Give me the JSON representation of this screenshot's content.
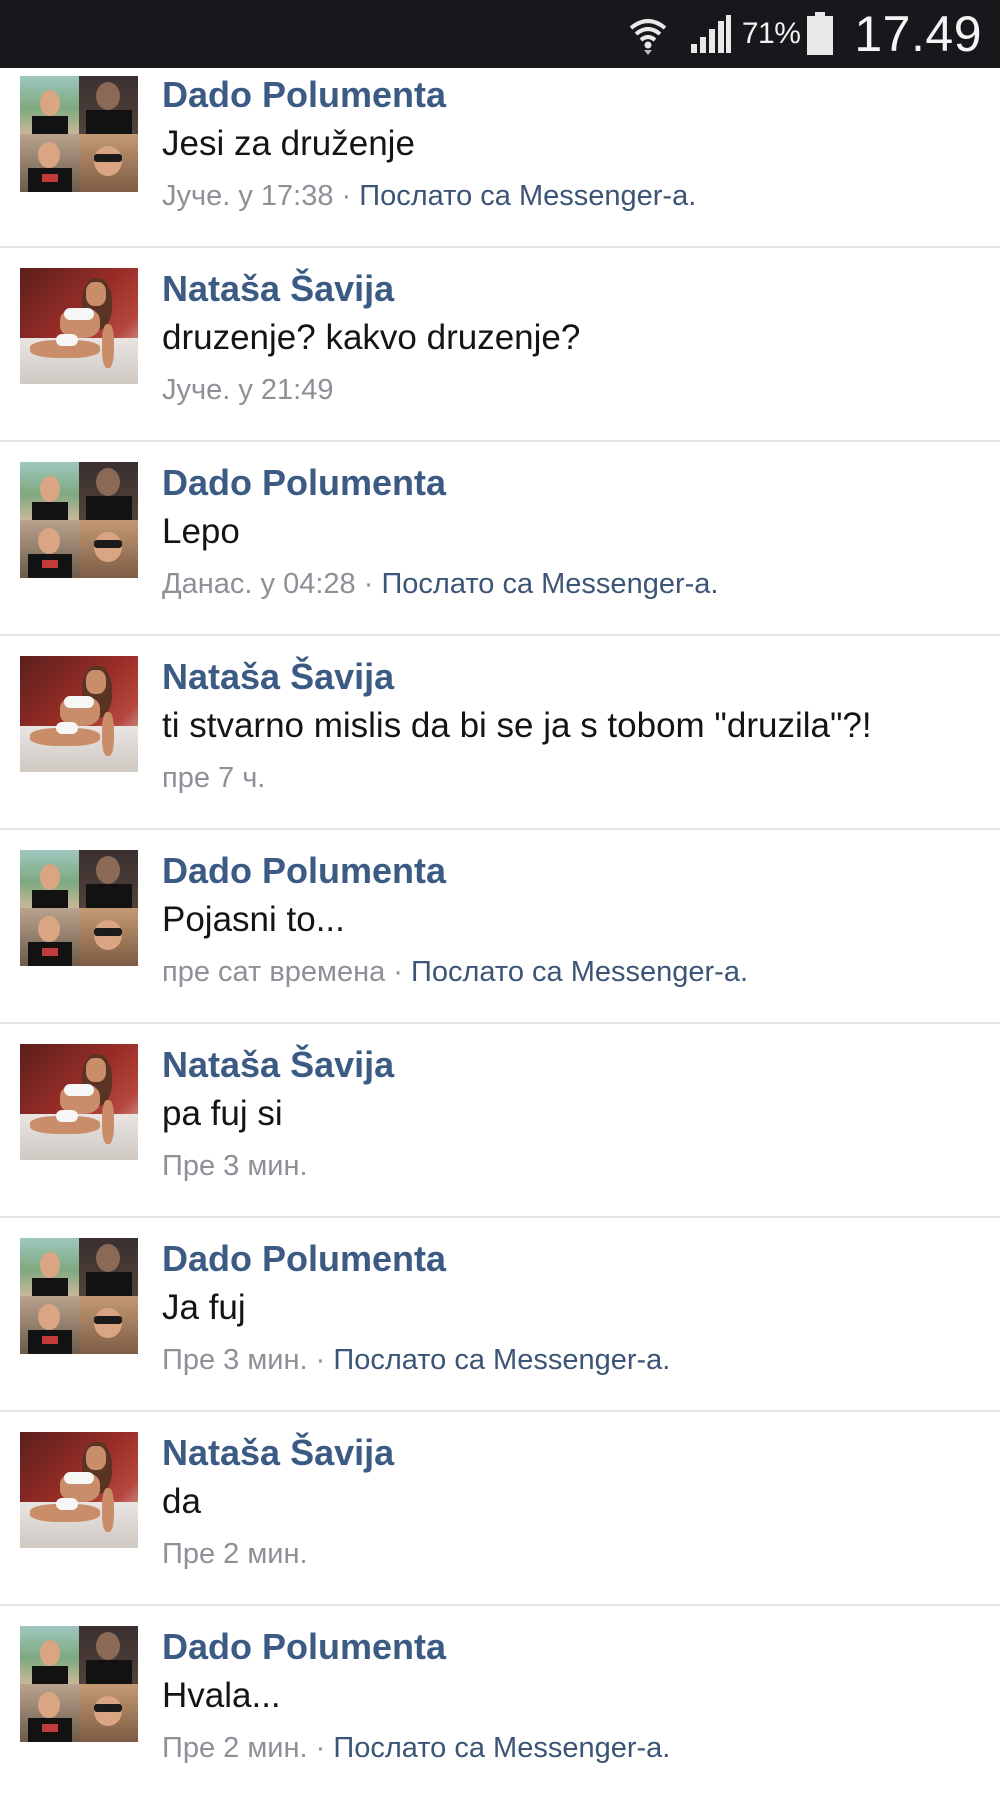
{
  "status_bar": {
    "battery_percent": "71%",
    "clock": "17.49",
    "icons": [
      "wifi-icon",
      "signal-icon",
      "battery-icon"
    ]
  },
  "messages": [
    {
      "sender": "Dado Polumenta",
      "avatar": "dado-avatar",
      "text": "Jesi za druženje",
      "time": "Јуче. у 17:38",
      "separator": " · ",
      "source": "Послато са Messenger-а."
    },
    {
      "sender": "Nataša Šavija",
      "avatar": "natasa-avatar",
      "text": "druzenje? kakvo druzenje?",
      "time": "Јуче. у 21:49"
    },
    {
      "sender": "Dado Polumenta",
      "avatar": "dado-avatar",
      "text": "Lepo",
      "time": "Данас. у 04:28",
      "separator": " · ",
      "source": "Послато са Messenger-а."
    },
    {
      "sender": "Nataša Šavija",
      "avatar": "natasa-avatar",
      "text": "ti stvarno mislis da bi se ja s tobom \"druzila\"?!",
      "time": "пре 7 ч."
    },
    {
      "sender": "Dado Polumenta",
      "avatar": "dado-avatar",
      "text": "Pojasni to...",
      "time": "пре сат времена",
      "separator": " · ",
      "source": "Послато са Messenger-а."
    },
    {
      "sender": "Nataša Šavija",
      "avatar": "natasa-avatar",
      "text": "pa fuj si",
      "time": "Пре 3 мин."
    },
    {
      "sender": "Dado Polumenta",
      "avatar": "dado-avatar",
      "text": "Ja fuj",
      "time": "Пре 3 мин.",
      "separator": " · ",
      "source": "Послато са Messenger-а."
    },
    {
      "sender": "Nataša Šavija",
      "avatar": "natasa-avatar",
      "text": "da",
      "time": "Пре 2 мин."
    },
    {
      "sender": "Dado Polumenta",
      "avatar": "dado-avatar",
      "text": "Hvala...",
      "time": "Пре 2 мин.",
      "separator": " · ",
      "source": "Послато са Messenger-а."
    }
  ]
}
